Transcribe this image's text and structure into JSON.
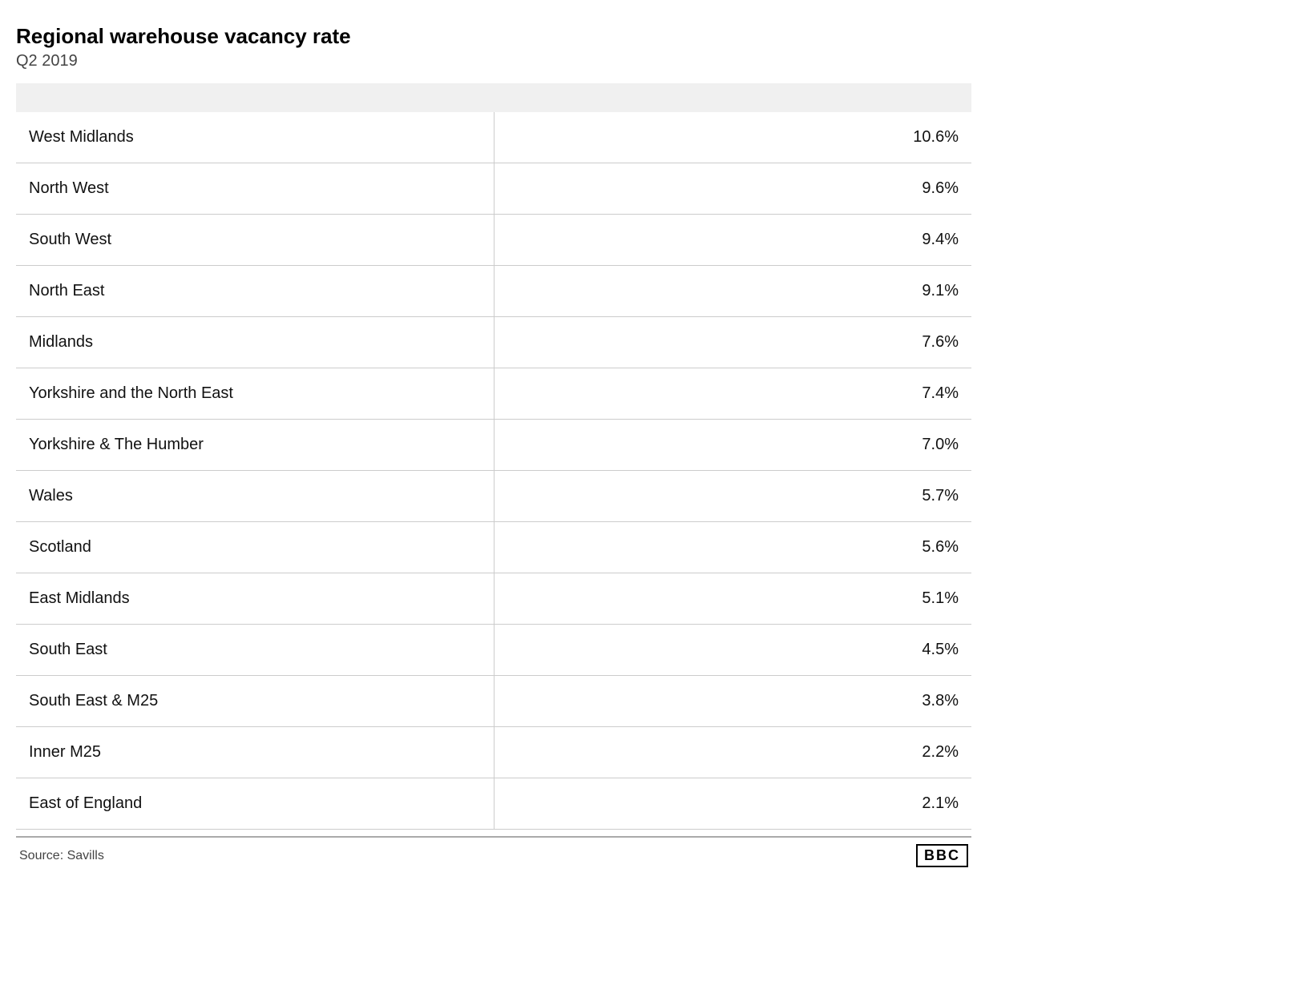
{
  "chart": {
    "title": "Regional warehouse vacancy rate",
    "subtitle": "Q2 2019",
    "source_label": "Source: Savills",
    "bbc_label": "BBC",
    "rows": [
      {
        "region": "West Midlands",
        "value": "10.6%"
      },
      {
        "region": "North West",
        "value": "9.6%"
      },
      {
        "region": "South West",
        "value": "9.4%"
      },
      {
        "region": "North East",
        "value": "9.1%"
      },
      {
        "region": "Midlands",
        "value": "7.6%"
      },
      {
        "region": "Yorkshire and the North East",
        "value": "7.4%"
      },
      {
        "region": "Yorkshire & The Humber",
        "value": "7.0%"
      },
      {
        "region": "Wales",
        "value": "5.7%"
      },
      {
        "region": "Scotland",
        "value": "5.6%"
      },
      {
        "region": "East Midlands",
        "value": "5.1%"
      },
      {
        "region": "South East",
        "value": "4.5%"
      },
      {
        "region": "South East & M25",
        "value": "3.8%"
      },
      {
        "region": "Inner M25",
        "value": "2.2%"
      },
      {
        "region": "East of England",
        "value": "2.1%"
      }
    ]
  }
}
